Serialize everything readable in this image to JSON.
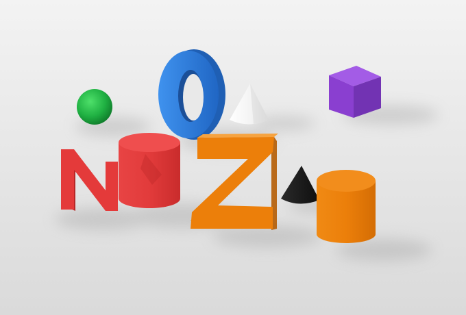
{
  "scene": {
    "background_top": "#f2f2f2",
    "background_bottom": "#dcdcdc",
    "objects": [
      {
        "id": "green-sphere",
        "kind": "sphere",
        "color": "#1fb042"
      },
      {
        "id": "blue-letter-o",
        "kind": "letter",
        "letter": "O",
        "color": "#2f7fde"
      },
      {
        "id": "white-cone",
        "kind": "cone",
        "color": "#f4f4f4"
      },
      {
        "id": "purple-cube",
        "kind": "cube",
        "color": "#8a3fd0"
      },
      {
        "id": "red-letter-n",
        "kind": "letter",
        "letter": "N",
        "color": "#e43a3a"
      },
      {
        "id": "red-cylinder",
        "kind": "cylinder",
        "color": "#e23b3b"
      },
      {
        "id": "orange-letter-z",
        "kind": "letter",
        "letter": "Z",
        "color": "#ec7f0a"
      },
      {
        "id": "black-cone",
        "kind": "cone",
        "color": "#1c1c1c"
      },
      {
        "id": "orange-cylinder",
        "kind": "cylinder",
        "color": "#ec7f0a"
      }
    ]
  }
}
